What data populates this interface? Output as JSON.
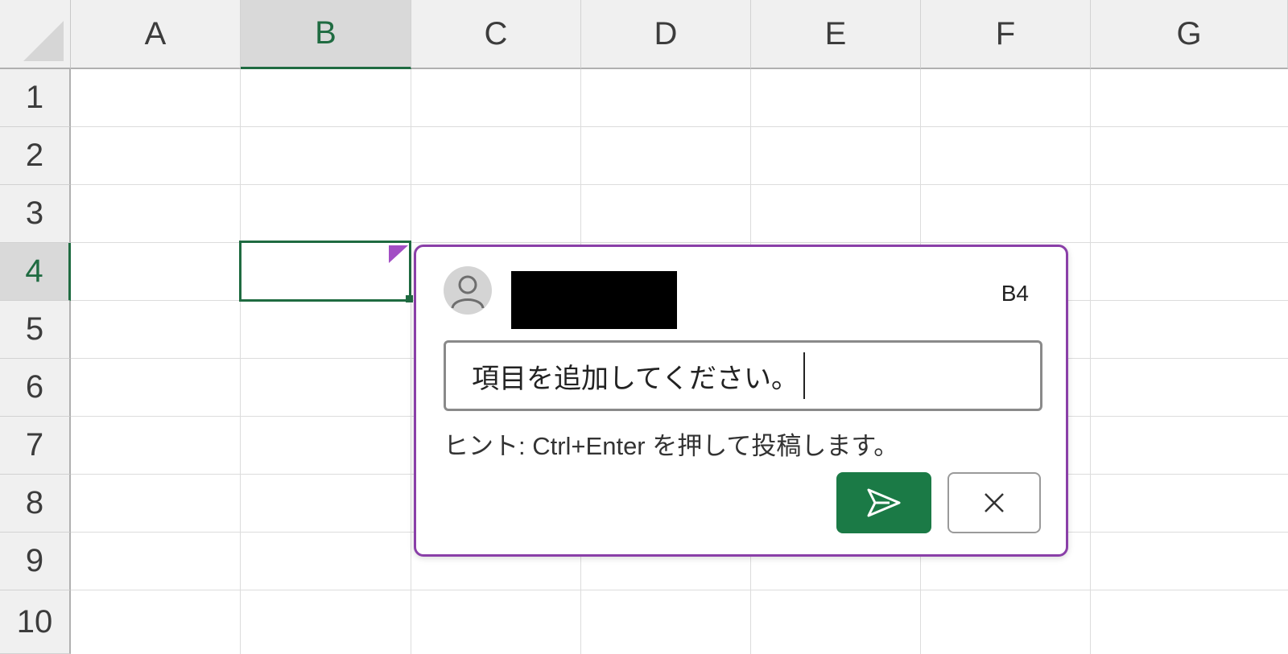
{
  "columns": [
    "A",
    "B",
    "C",
    "D",
    "E",
    "F",
    "G"
  ],
  "rows": [
    "1",
    "2",
    "3",
    "4",
    "5",
    "6",
    "7",
    "8",
    "9",
    "10"
  ],
  "selected": {
    "column": "B",
    "row": "4"
  },
  "comment": {
    "cell_ref": "B4",
    "input_value": "項目を追加してください。",
    "hint": "ヒント: Ctrl+Enter を押して投稿します。",
    "post_icon": "send-icon",
    "cancel_icon": "close-icon"
  },
  "colors": {
    "accent_green": "#1b7a46",
    "comment_border": "#8a3fa8",
    "comment_indicator": "#a24ec4"
  }
}
